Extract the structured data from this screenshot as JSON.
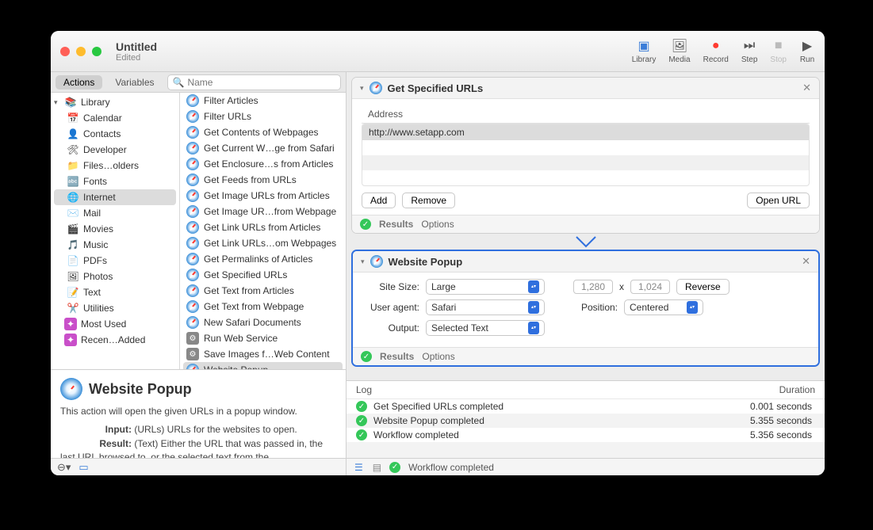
{
  "window": {
    "title": "Untitled",
    "subtitle": "Edited"
  },
  "toolbar": {
    "library": "Library",
    "media": "Media",
    "record": "Record",
    "step": "Step",
    "stop": "Stop",
    "run": "Run"
  },
  "tabs": {
    "actions": "Actions",
    "variables": "Variables"
  },
  "search": {
    "placeholder": "Name"
  },
  "library": {
    "root": "Library",
    "items": [
      "Calendar",
      "Contacts",
      "Developer",
      "Files…olders",
      "Fonts",
      "Internet",
      "Mail",
      "Movies",
      "Music",
      "PDFs",
      "Photos",
      "Text",
      "Utilities"
    ],
    "selected": "Internet",
    "extra": [
      "Most Used",
      "Recen…Added"
    ]
  },
  "actions": {
    "items": [
      "Filter Articles",
      "Filter URLs",
      "Get Contents of Webpages",
      "Get Current W…ge from Safari",
      "Get Enclosure…s from Articles",
      "Get Feeds from URLs",
      "Get Image URLs from Articles",
      "Get Image UR…from Webpage",
      "Get Link URLs from Articles",
      "Get Link URLs…om Webpages",
      "Get Permalinks of Articles",
      "Get Specified URLs",
      "Get Text from Articles",
      "Get Text from Webpage",
      "New Safari Documents",
      "Run Web Service",
      "Save Images f…Web Content",
      "Website Popup"
    ],
    "selected": "Website Popup"
  },
  "description": {
    "title": "Website Popup",
    "body": "This action will open the given URLs in a popup window.",
    "input_label": "Input:",
    "input": "(URLs) URLs for the websites to open.",
    "result_label": "Result:",
    "result": "(Text) Either the URL that was passed in, the last URL browsed to, or the selected text from the"
  },
  "workflow": {
    "card1": {
      "title": "Get Specified URLs",
      "table_header": "Address",
      "rows": [
        "http://www.setapp.com"
      ],
      "add": "Add",
      "remove": "Remove",
      "open": "Open URL",
      "results": "Results",
      "options": "Options"
    },
    "card2": {
      "title": "Website Popup",
      "site_size_label": "Site Size:",
      "site_size": "Large",
      "width": "1,280",
      "x": "x",
      "height": "1,024",
      "reverse": "Reverse",
      "ua_label": "User agent:",
      "ua": "Safari",
      "pos_label": "Position:",
      "pos": "Centered",
      "out_label": "Output:",
      "out": "Selected Text",
      "results": "Results",
      "options": "Options"
    }
  },
  "log": {
    "h1": "Log",
    "h2": "Duration",
    "rows": [
      {
        "msg": "Get Specified URLs completed",
        "dur": "0.001 seconds"
      },
      {
        "msg": "Website Popup completed",
        "dur": "5.355 seconds"
      },
      {
        "msg": "Workflow completed",
        "dur": "5.356 seconds"
      }
    ]
  },
  "footer": {
    "status": "Workflow completed"
  }
}
